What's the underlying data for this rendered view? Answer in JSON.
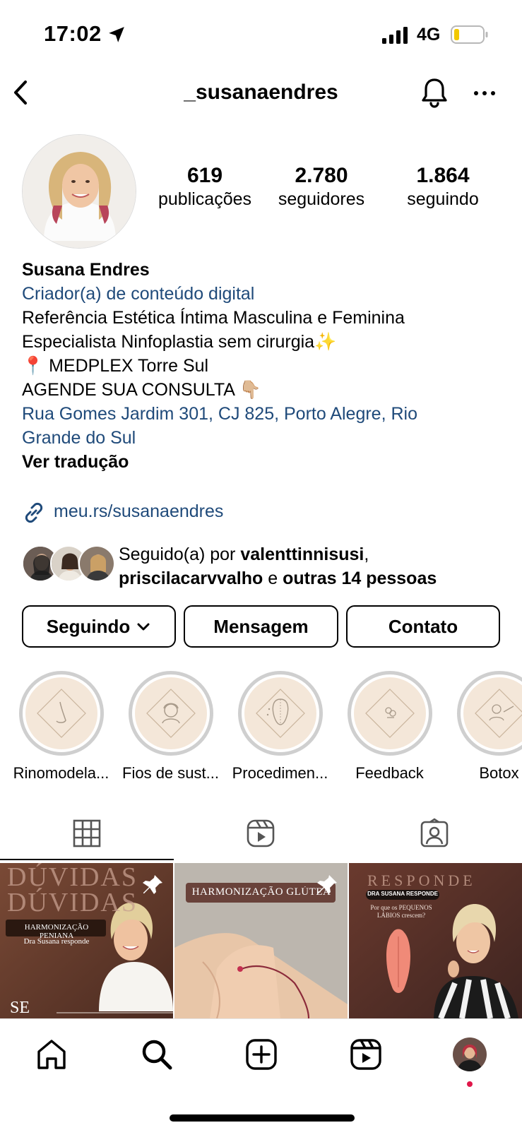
{
  "status": {
    "time": "17:02",
    "network": "4G"
  },
  "header": {
    "username": "_susanaendres"
  },
  "profile": {
    "stats": [
      {
        "value": "619",
        "label": "publicações"
      },
      {
        "value": "2.780",
        "label": "seguidores"
      },
      {
        "value": "1.864",
        "label": "seguindo"
      }
    ],
    "name": "Susana Endres",
    "category": "Criador(a) de conteúdo digital",
    "bio_line1": "Referência Estética Íntima Masculina e Feminina",
    "bio_line2": "Especialista Ninfoplastia sem cirurgia✨",
    "bio_line3": "📍 MEDPLEX Torre Sul",
    "bio_line4": "AGENDE SUA CONSULTA 👇🏼",
    "address": "Rua Gomes Jardim 301, CJ 825, Porto Alegre, Rio Grande do Sul",
    "translate": "Ver tradução",
    "link": "meu.rs/susanaendres"
  },
  "followed_by": {
    "prefix": "Seguido(a) por ",
    "user1": "valenttinnisusi",
    "sep": ",",
    "user2": "priscilacarvvalho",
    "conj": " e ",
    "others": "outras 14 pessoas"
  },
  "buttons": {
    "following": "Seguindo",
    "message": "Mensagem",
    "contact": "Contato"
  },
  "highlights": [
    {
      "label": "Rinomodela..."
    },
    {
      "label": "Fios de sust..."
    },
    {
      "label": "Procedimen..."
    },
    {
      "label": "Feedback"
    },
    {
      "label": "Botox"
    }
  ],
  "posts": [
    {
      "title": "DÚVIDAS",
      "subtitle": "HARMONIZAÇÃO PENIANA",
      "caption": "Dra Susana responde",
      "corner": "SE"
    },
    {
      "title": "HARMONIZAÇÃO GLÚTEA"
    },
    {
      "title": "RESPONDE",
      "subtitle": "DRA SUSANA RESPONDE",
      "caption": "Por que os PEQUENOS LÁBIOS crescem?"
    }
  ]
}
